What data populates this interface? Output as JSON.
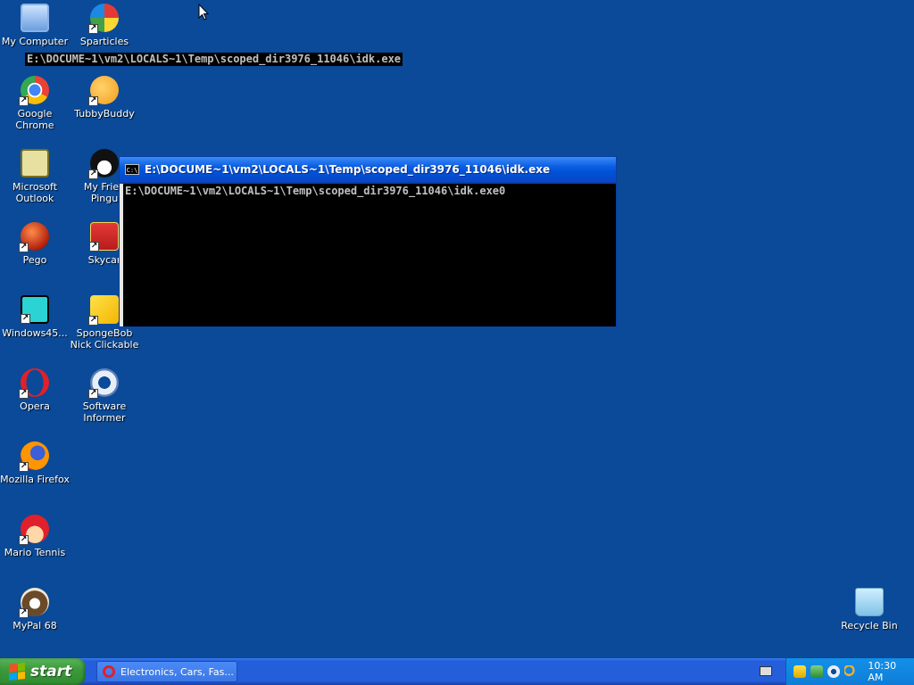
{
  "desktop": {
    "icons": [
      {
        "label": "My Computer",
        "icon": "computer-icon"
      },
      {
        "label": "Sparticles",
        "icon": "sparticles-icon"
      },
      {
        "label": "Google Chrome",
        "icon": "chrome-icon"
      },
      {
        "label": "TubbyBuddy",
        "icon": "tubbybuddy-icon"
      },
      {
        "label": "Microsoft\nOutlook",
        "icon": "outlook-icon"
      },
      {
        "label": "My Frien\nPingu",
        "icon": "pingu-icon"
      },
      {
        "label": "Pego",
        "icon": "pego-icon"
      },
      {
        "label": "Skycar",
        "icon": "skycar-icon"
      },
      {
        "label": "Windows45...",
        "icon": "windows45-icon"
      },
      {
        "label": "SpongeBob\nNick Clickable",
        "icon": "spongebob-icon"
      },
      {
        "label": "Opera",
        "icon": "opera-icon"
      },
      {
        "label": "Software\nInformer",
        "icon": "software-informer-icon"
      },
      {
        "label": "Mozilla Firefox",
        "icon": "firefox-icon"
      },
      {
        "label": "Mario Tennis",
        "icon": "mario-tennis-icon"
      },
      {
        "label": "MyPal 68",
        "icon": "mypal-icon"
      },
      {
        "label": "Recycle Bin",
        "icon": "recycle-bin-icon"
      }
    ],
    "cmdline_text": "E:\\DOCUME~1\\vm2\\LOCALS~1\\Temp\\scoped_dir3976_11046\\idk.exe"
  },
  "cmd_window": {
    "icon_text": "C:\\",
    "title": "E:\\DOCUME~1\\vm2\\LOCALS~1\\Temp\\scoped_dir3976_11046\\idk.exe",
    "output": "E:\\DOCUME~1\\vm2\\LOCALS~1\\Temp\\scoped_dir3976_11046\\idk.exe0"
  },
  "taskbar": {
    "start_label": "start",
    "task_item_label": "Electronics, Cars, Fas...",
    "clock": "10:30 AM"
  },
  "colors": {
    "desktop": "#0a4a98",
    "taskbar": "#245edb",
    "start_button": "#3c9b3c",
    "tray": "#0f7dd8"
  }
}
